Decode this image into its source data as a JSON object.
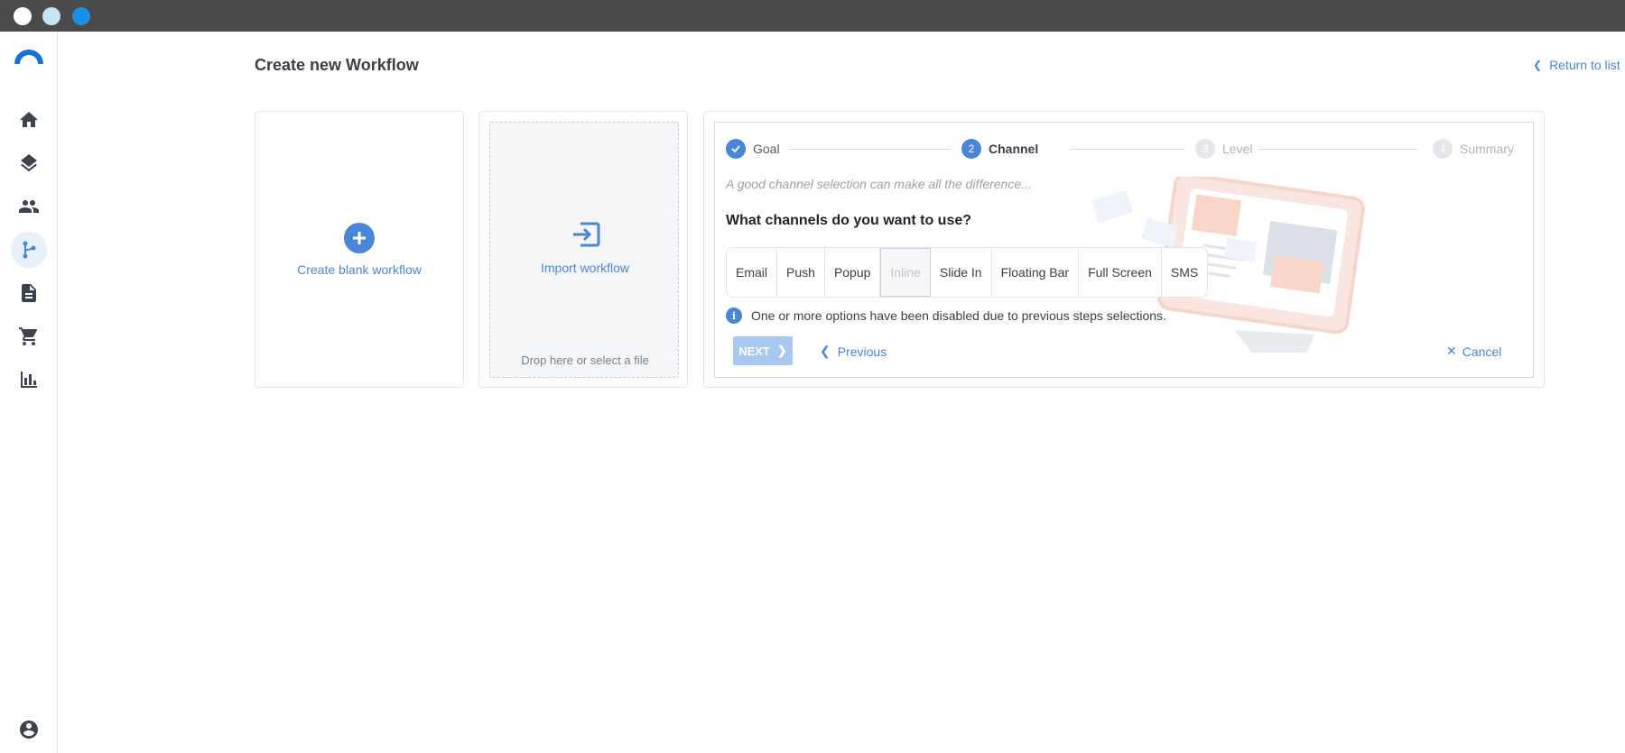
{
  "window": {
    "controls": [
      "close",
      "minimize",
      "maximize"
    ]
  },
  "sidebar": {
    "logo": "brand-logo",
    "items": [
      {
        "icon": "home-icon",
        "active": false
      },
      {
        "icon": "layers-icon",
        "active": false
      },
      {
        "icon": "users-icon",
        "active": false
      },
      {
        "icon": "workflow-icon",
        "active": true
      },
      {
        "icon": "document-icon",
        "active": false
      },
      {
        "icon": "cart-icon",
        "active": false
      },
      {
        "icon": "bar-chart-icon",
        "active": false
      },
      {
        "icon": "account-icon",
        "active": false
      }
    ]
  },
  "header": {
    "title": "Create new Workflow",
    "return_label": "Return to list"
  },
  "cards": {
    "blank": {
      "label": "Create blank workflow"
    },
    "import": {
      "label": "Import workflow",
      "drop_hint": "Drop here or select a file"
    }
  },
  "wizard": {
    "steps": [
      {
        "number": "1",
        "label": "Goal",
        "state": "done"
      },
      {
        "number": "2",
        "label": "Channel",
        "state": "current"
      },
      {
        "number": "3",
        "label": "Level",
        "state": "pending"
      },
      {
        "number": "4",
        "label": "Summary",
        "state": "pending"
      }
    ],
    "hint": "A good channel selection can make all the difference...",
    "question": "What channels do you want to use?",
    "channels": [
      {
        "label": "Email",
        "disabled": false
      },
      {
        "label": "Push",
        "disabled": false
      },
      {
        "label": "Popup",
        "disabled": false
      },
      {
        "label": "Inline",
        "disabled": true
      },
      {
        "label": "Slide In",
        "disabled": false
      },
      {
        "label": "Floating Bar",
        "disabled": false
      },
      {
        "label": "Full Screen",
        "disabled": false
      },
      {
        "label": "SMS",
        "disabled": false
      }
    ],
    "info": "One or more options have been disabled due to previous steps selections.",
    "next_label": "NEXT",
    "previous_label": "Previous",
    "cancel_label": "Cancel"
  },
  "colors": {
    "accent": "#4a86d8",
    "titlebar": "#4a4a4a",
    "disabled_button": "#a9c8f0"
  }
}
